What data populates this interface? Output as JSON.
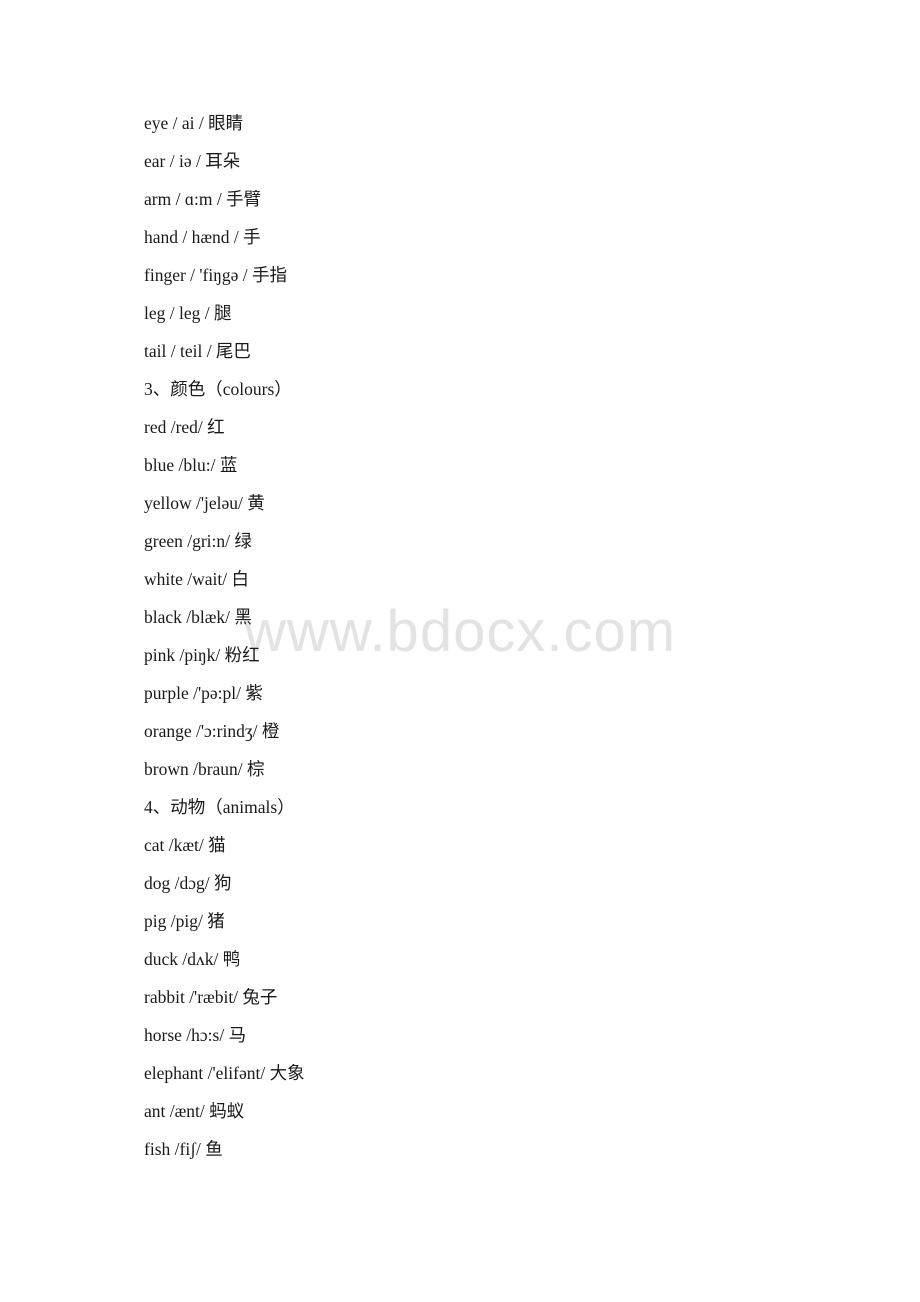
{
  "document": {
    "watermark": "www.bdocx.com",
    "lines": [
      {
        "text": "eye / ai / 眼睛",
        "type": "entry"
      },
      {
        "text": "ear / iə / 耳朵",
        "type": "entry"
      },
      {
        "text": "arm / ɑ:m / 手臂",
        "type": "entry"
      },
      {
        "text": "hand / hænd / 手",
        "type": "entry"
      },
      {
        "text": "finger / 'fiŋgə / 手指",
        "type": "entry"
      },
      {
        "text": "leg / leg / 腿",
        "type": "entry"
      },
      {
        "text": "tail / teil / 尾巴",
        "type": "entry"
      },
      {
        "text": "3、颜色（colours）",
        "type": "heading"
      },
      {
        "text": "red /red/ 红",
        "type": "entry"
      },
      {
        "text": "blue /blu:/ 蓝",
        "type": "entry"
      },
      {
        "text": "yellow /'jeləu/ 黄",
        "type": "entry"
      },
      {
        "text": "green /gri:n/ 绿",
        "type": "entry"
      },
      {
        "text": "white /wait/ 白",
        "type": "entry"
      },
      {
        "text": "black /blæk/ 黑",
        "type": "entry"
      },
      {
        "text": "pink /piŋk/ 粉红",
        "type": "entry"
      },
      {
        "text": "purple /'pə:pl/ 紫",
        "type": "entry"
      },
      {
        "text": "orange /'ɔ:rindʒ/ 橙",
        "type": "entry"
      },
      {
        "text": "brown /braun/ 棕",
        "type": "entry"
      },
      {
        "text": "4、动物（animals）",
        "type": "heading"
      },
      {
        "text": "cat /kæt/ 猫",
        "type": "entry"
      },
      {
        "text": "dog /dɔg/ 狗",
        "type": "entry"
      },
      {
        "text": "pig /pig/ 猪",
        "type": "entry"
      },
      {
        "text": "duck /dʌk/ 鸭",
        "type": "entry"
      },
      {
        "text": "rabbit /'ræbit/ 兔子",
        "type": "entry"
      },
      {
        "text": "horse /hɔ:s/ 马",
        "type": "entry"
      },
      {
        "text": "elephant /'elifənt/ 大象",
        "type": "entry"
      },
      {
        "text": "ant /ænt/ 蚂蚁",
        "type": "entry"
      },
      {
        "text": "fish /fiʃ/ 鱼",
        "type": "entry"
      }
    ]
  }
}
